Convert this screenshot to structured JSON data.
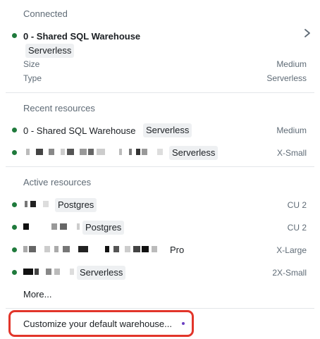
{
  "connected": {
    "header": "Connected",
    "name": "0 - Shared SQL Warehouse",
    "tag": "Serverless",
    "size_key": "Size",
    "size_value": "Medium",
    "type_key": "Type",
    "type_value": "Serverless"
  },
  "recent": {
    "header": "Recent resources",
    "items": [
      {
        "name": "0 - Shared SQL Warehouse",
        "tag": "Serverless",
        "right": "Medium"
      },
      {
        "name": "",
        "tag": "Serverless",
        "right": "X-Small"
      }
    ]
  },
  "active": {
    "header": "Active resources",
    "items": [
      {
        "tag": "Postgres",
        "right": "CU 2"
      },
      {
        "tag": "Postgres",
        "right": "CU 2"
      },
      {
        "tag": "Pro",
        "right": "X-Large"
      },
      {
        "tag": "Serverless",
        "right": "2X-Small"
      }
    ],
    "more": "More..."
  },
  "customize": {
    "label": "Customize your default warehouse..."
  },
  "colors": {
    "status_green": "#1f7a3c",
    "highlight_red": "#e2352a",
    "accent_purple": "#6a3fc2"
  },
  "icons": {
    "chevron": "chevron-right-icon",
    "status": "status-dot-icon"
  }
}
